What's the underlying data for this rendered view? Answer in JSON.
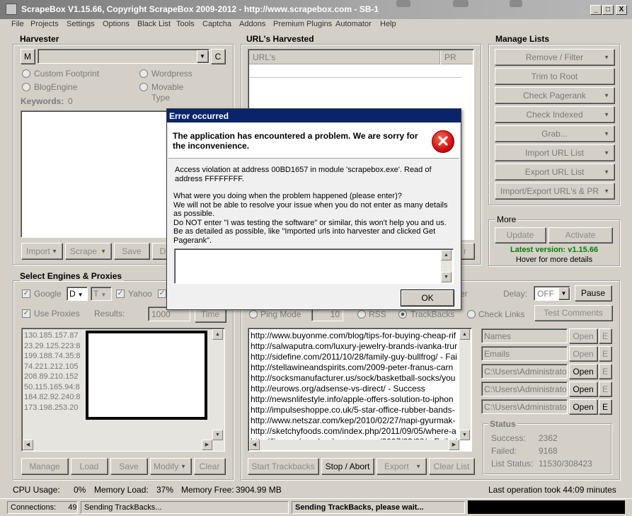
{
  "window": {
    "title": "ScrapeBox V1.15.66, Copyright ScrapeBox 2009-2012 - http://www.scrapebox.com - SB-1",
    "min": "_",
    "max": "□",
    "close": "X"
  },
  "menu": [
    "File",
    "Projects",
    "Settings",
    "Options",
    "Black List",
    "Tools",
    "Captcha",
    "Addons",
    "Premium Plugins",
    "Automator",
    "Help"
  ],
  "harvester": {
    "title": "Harvester",
    "m_label": "M",
    "c_label": "C",
    "radios": [
      "Custom Footprint",
      "Wordpress",
      "BlogEngine",
      "Movable Type"
    ],
    "keywords_label": "Keywords:",
    "keywords_count": "0",
    "buttons": [
      "Import",
      "Scrape",
      "Save",
      "D"
    ]
  },
  "urls_harvested": {
    "title": "URL's Harvested",
    "col_urls": "URL's",
    "col_pr": "PR",
    "partial_btn": "r"
  },
  "manage_lists": {
    "title": "Manage Lists",
    "buttons": [
      "Remove / Filter",
      "Trim to Root",
      "Check Pagerank",
      "Check Indexed",
      "Grab...",
      "Import URL List",
      "Export URL List",
      "Import/Export URL's & PR"
    ]
  },
  "more": {
    "title": "More",
    "update": "Update",
    "activate": "Activate",
    "latest": "Latest version: v1.15.66",
    "hover": "Hover for more details"
  },
  "engines": {
    "title": "Select Engines & Proxies",
    "google": "Google",
    "google_dd": "D",
    "t_dd": "T",
    "yahoo": "Yahoo",
    "use_proxies": "Use Proxies",
    "results_label": "Results:",
    "results_value": "1000",
    "time_btn": "Time",
    "proxies": [
      "130.185.157.87",
      "23.29.125.223:8",
      "199.188.74.35:8",
      "74.221.212.105",
      "208.89.210.152",
      "50.115.165.94:8",
      "184.82.92.240:8",
      "173.198.253.20"
    ],
    "buttons": [
      "Manage",
      "Load",
      "Save",
      "Modify",
      "Clear"
    ]
  },
  "poster": {
    "delay_label": "Delay:",
    "delay_value": "OFF",
    "pause": "Pause",
    "er_partial": "er",
    "ping_mode": "Ping Mode",
    "ping_value": "10",
    "rss": "RSS",
    "trackbacks": "TrackBacks",
    "check_links": "Check Links",
    "test_comments": "Test Comments",
    "log": [
      "http://www.buyonme.com/blog/tips-for-buying-cheap-rif",
      "http://salwaputra.com/luxury-jewelry-brands-ivanka-trur",
      "http://sidefine.com/2011/10/28/family-guy-bullfrog/ - Fai",
      "http://stellawineandspirits.com/2009-peter-franus-carn",
      "http://socksmanufacturer.us/sock/basketball-socks/you",
      "http://eurows.org/adsense-vs-direct/ - Success",
      "http://newsnlifestyle.info/apple-offers-solution-to-iphon",
      "http://impulseshoppe.co.uk/5-star-office-rubber-bands-",
      "http://www.netszar.com/kep/2010/02/27/napi-gyurmak-",
      "http://sketchyfoods.com/index.php/2011/09/05/where-a",
      "http://linguaphonelandscapes.com/2007/03/28/ - Failed"
    ],
    "buttons": [
      "Start Trackbacks",
      "Stop / Abort",
      "Export",
      "Clear List"
    ]
  },
  "files": {
    "rows": [
      {
        "value": "Names",
        "open": "Open",
        "e": "E"
      },
      {
        "value": "Emails",
        "open": "Open",
        "e": "E"
      },
      {
        "value": "C:\\Users\\Administrato",
        "open": "Open",
        "e": "E"
      },
      {
        "value": "C:\\Users\\Administrato",
        "open": "Open",
        "e": "E"
      },
      {
        "value": "C:\\Users\\Administrato",
        "open": "Open",
        "e": "E"
      }
    ]
  },
  "status_box": {
    "title": "Status",
    "success_label": "Success:",
    "success": "2362",
    "failed_label": "Failed:",
    "failed": "9168",
    "list_label": "List Status:",
    "list": "11530/308423"
  },
  "footer": {
    "cpu_label": "CPU Usage:",
    "cpu": "0%",
    "memload_label": "Memory Load:",
    "memload": "37%",
    "memfree_label": "Memory Free:",
    "memfree": "3904.99 MB",
    "last_op": "Last operation took 44:09 minutes",
    "connections_label": "Connections:",
    "connections": "49",
    "sending": "Sending TrackBacks...",
    "sending_wait": "Sending TrackBacks, please wait..."
  },
  "dialog": {
    "title": "Error occurred",
    "headline": "The application has encountered a problem. We are sorry for the inconvenience.",
    "icon": "error-icon",
    "detail": "Access violation at address 00BD1657 in module 'scrapebox.exe'. Read of address FFFFFFFF.",
    "prompt": "What were you doing when the problem happened (please enter)?\nWe will not be able to resolve your issue when you do not enter as many details as possible.\nDo NOT enter \"I was testing the software\" or similar, this won't help you and us.\nBe as detailed as possible, like \"Imported urls into harvester and clicked Get Pagerank\".",
    "ok": "OK"
  }
}
